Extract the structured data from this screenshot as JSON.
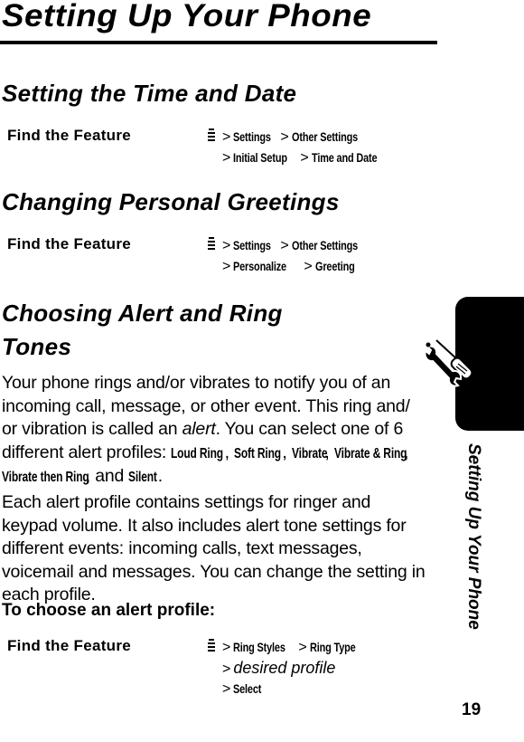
{
  "page": {
    "title": "Setting Up Your Phone",
    "side_tab_text": "Setting Up Your Phone",
    "side_tab_icon": "wrench-screwdriver-icon",
    "page_number": "19"
  },
  "sections": [
    {
      "heading": "Setting the Time and Date",
      "find_feature": {
        "label": "Find the Feature",
        "icon": "menu-key-icon",
        "lines": [
          [
            "Settings",
            "Other Settings"
          ],
          [
            "Initial Setup",
            "Time and Date"
          ]
        ]
      }
    },
    {
      "heading": "Changing Personal Greetings",
      "find_feature": {
        "label": "Find the Feature",
        "icon": "menu-key-icon",
        "lines": [
          [
            "Settings",
            "Other Settings"
          ],
          [
            "Personalize",
            "Greeting"
          ]
        ]
      }
    },
    {
      "heading_line1": "Choosing Alert and Ring",
      "heading_line2": "Tones",
      "paragraph1": {
        "part1": "Your phone rings and/or vibrates to notify you of an incoming call, message, or other event. This ring and/ or vibration is called an ",
        "italic": "alert",
        "part2": ". You can select one of 6 different alert profiles: ",
        "profiles": [
          "Loud Ring",
          "Soft Ring",
          "Vibrate",
          "Vibrate & Ring",
          "Vibrate then Ring",
          "Silent"
        ],
        "sep": ", ",
        "and": "and ",
        "end": "."
      },
      "paragraph2": "Each alert profile contains settings for ringer and keypad volume. It also includes alert tone settings for different events: incoming calls, text messages, voicemail and messages. You can change the setting in each profile.",
      "subheading": "To choose an alert profile:",
      "find_feature": {
        "label": "Find the Feature",
        "icon": "menu-key-icon",
        "line1": [
          "Ring Styles",
          "Ring Type"
        ],
        "line2_italic": "desired profile",
        "line3": "Select"
      }
    }
  ],
  "separator": ">"
}
